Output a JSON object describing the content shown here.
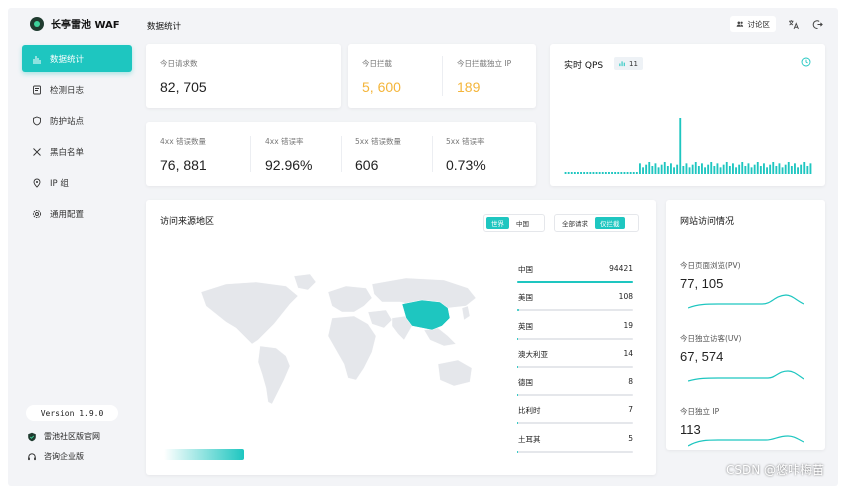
{
  "brand": {
    "name": "长亭雷池 WAF"
  },
  "sidebar": {
    "items": [
      {
        "label": "数据统计",
        "icon": "bar-chart-icon",
        "active": true
      },
      {
        "label": "检测日志",
        "icon": "log-icon",
        "active": false
      },
      {
        "label": "防护站点",
        "icon": "shield-icon",
        "active": false
      },
      {
        "label": "黑白名单",
        "icon": "tools-icon",
        "active": false
      },
      {
        "label": "IP 组",
        "icon": "location-icon",
        "active": false
      },
      {
        "label": "通用配置",
        "icon": "gear-icon",
        "active": false
      }
    ],
    "version": "Version 1.9.0",
    "community_link": "雷池社区版官网",
    "enterprise_link": "咨询企业版"
  },
  "header": {
    "title": "数据统计",
    "forum_label": "讨论区"
  },
  "stats": {
    "requests_label": "今日请求数",
    "requests_value": "82, 705",
    "blocked_label": "今日拦截",
    "blocked_value": "5, 600",
    "blocked_ip_label": "今日拦截独立 IP",
    "blocked_ip_value": "189",
    "err4_count_label": "4xx 错误数量",
    "err4_count_value": "76, 881",
    "err4_rate_label": "4xx 错误率",
    "err4_rate_value": "92.96%",
    "err5_count_label": "5xx 错误数量",
    "err5_count_value": "606",
    "err5_rate_label": "5xx 错误率",
    "err5_rate_value": "0.73%"
  },
  "qps": {
    "title": "实时 QPS",
    "badge_value": "11",
    "series": [
      3,
      3,
      3,
      3,
      3,
      3,
      3,
      3,
      3,
      3,
      3,
      3,
      3,
      3,
      3,
      3,
      3,
      3,
      3,
      3,
      3,
      3,
      3,
      3,
      3,
      3,
      3,
      3,
      3,
      3,
      3,
      3,
      3,
      3,
      3,
      3,
      3,
      3,
      3,
      3,
      3,
      3,
      3,
      3,
      3,
      3,
      3,
      3,
      3,
      3,
      3,
      3,
      3,
      3,
      3,
      3,
      3,
      3,
      3,
      3,
      3,
      3,
      3,
      3,
      3,
      3,
      3,
      3,
      3,
      3,
      3,
      3,
      3,
      3,
      3,
      3,
      3,
      3,
      3,
      3,
      3,
      3,
      3,
      3,
      3,
      3,
      3,
      3,
      3,
      3,
      3,
      3,
      3,
      3,
      3,
      3,
      3,
      3,
      3,
      3,
      3,
      3,
      3,
      3,
      3,
      3,
      3,
      3,
      3,
      3,
      3,
      3,
      3,
      3,
      3,
      3,
      3,
      3,
      3,
      3,
      3,
      3,
      3,
      3,
      3,
      3,
      3,
      3,
      3,
      3,
      3,
      3,
      3,
      3,
      3,
      3,
      3,
      3,
      3,
      3,
      3,
      3,
      3,
      3,
      3,
      3,
      3,
      3,
      3,
      3,
      3,
      3,
      3,
      3,
      3,
      3,
      3,
      3,
      3,
      3,
      3,
      3,
      3,
      3,
      3,
      3,
      3,
      3,
      3,
      3,
      3,
      3,
      3,
      3,
      3,
      3,
      3,
      3,
      3,
      3,
      3,
      3,
      3,
      3,
      3,
      3,
      3,
      3,
      3,
      3,
      3,
      3,
      3,
      3,
      3,
      3,
      3,
      3,
      3,
      3,
      3,
      3,
      3,
      3,
      3,
      3,
      3,
      3,
      3,
      3,
      3,
      3,
      3,
      3,
      3,
      3,
      3,
      3,
      3,
      3,
      3,
      3,
      3,
      3,
      3,
      3,
      3,
      3,
      3,
      3
    ]
  },
  "map": {
    "title": "访问来源地区",
    "scope_tabs": [
      "世界",
      "中国"
    ],
    "scope_active": 0,
    "filter_tabs": [
      "全部请求",
      "仅拦截"
    ],
    "filter_active": 1,
    "countries": [
      {
        "name": "中国",
        "value": "94421",
        "ratio": 1.0
      },
      {
        "name": "美国",
        "value": "108",
        "ratio": 0.02
      },
      {
        "name": "英国",
        "value": "19",
        "ratio": 0.01
      },
      {
        "name": "澳大利亚",
        "value": "14",
        "ratio": 0.01
      },
      {
        "name": "德国",
        "value": "8",
        "ratio": 0.005
      },
      {
        "name": "比利时",
        "value": "7",
        "ratio": 0.005
      },
      {
        "name": "土耳其",
        "value": "5",
        "ratio": 0.005
      }
    ],
    "highlight_color": "#1ec6c0"
  },
  "site": {
    "title": "网站访问情况",
    "pv_label": "今日页面浏览(PV)",
    "pv_value": "77, 105",
    "uv_label": "今日独立访客(UV)",
    "uv_value": "67, 574",
    "ip_label": "今日独立 IP",
    "ip_value": "113"
  },
  "watermark": "CSDN @悠咔梅苗",
  "colors": {
    "accent": "#1ec6c0",
    "orange": "#f4b53a",
    "background": "#f3f4f7"
  }
}
